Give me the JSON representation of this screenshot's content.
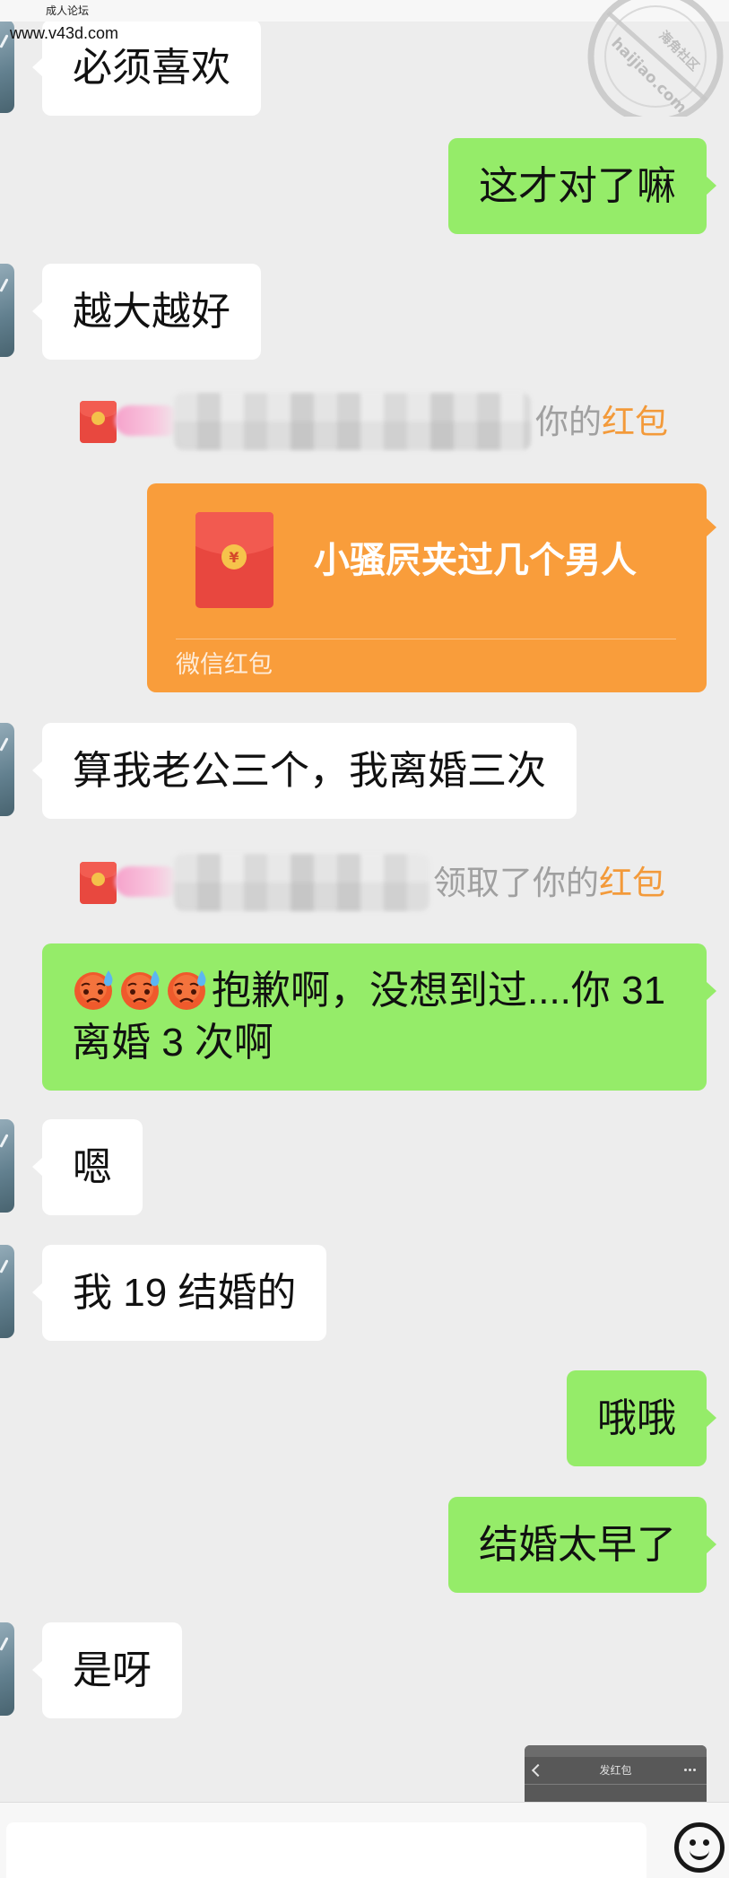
{
  "overlay": {
    "site_label": "成人论坛",
    "site_url": "www.v43d.com",
    "watermark_cn": "海角社区",
    "watermark_en": "haijiao.com"
  },
  "colors": {
    "background": "#ededed",
    "bubble_sent": "#95ec69",
    "bubble_received": "#ffffff",
    "red_packet": "#f99d3b",
    "red_packet_link": "#f39a3a",
    "notice_text": "#a0a0a0"
  },
  "messages": [
    {
      "side": "received",
      "text": "必须喜欢"
    },
    {
      "side": "sent",
      "text": "这才对了嘛"
    },
    {
      "side": "received",
      "text": "越大越好"
    },
    {
      "side": "received",
      "text": "算我老公三个，我离婚三次"
    },
    {
      "side": "sent",
      "emojis": [
        "sweat-face-icon",
        "sweat-face-icon",
        "sweat-face-icon"
      ],
      "text": "抱歉啊，没想到过....你 31 离婚 3 次啊"
    },
    {
      "side": "received",
      "text": "嗯"
    },
    {
      "side": "received",
      "text": "我 19 结婚的"
    },
    {
      "side": "sent",
      "text": "哦哦"
    },
    {
      "side": "sent",
      "text": "结婚太早了"
    },
    {
      "side": "received",
      "text": "是呀"
    }
  ],
  "red_packet": {
    "side": "sent",
    "message": "小骚屄夹过几个男人",
    "footer": "微信红包",
    "icon": "red-envelope-icon",
    "currency_symbol": "¥"
  },
  "system_notices": [
    {
      "icon": "red-envelope-icon",
      "text": "你的",
      "link": "红包"
    },
    {
      "icon": "red-envelope-icon",
      "text": "领取了你的",
      "link": "红包"
    }
  ],
  "image_message": {
    "side": "sent",
    "title": "发红包",
    "icons": [
      "back-arrow-icon",
      "more-icon"
    ]
  },
  "input_bar": {
    "value": "",
    "placeholder": "",
    "icon": "emoji-icon"
  }
}
